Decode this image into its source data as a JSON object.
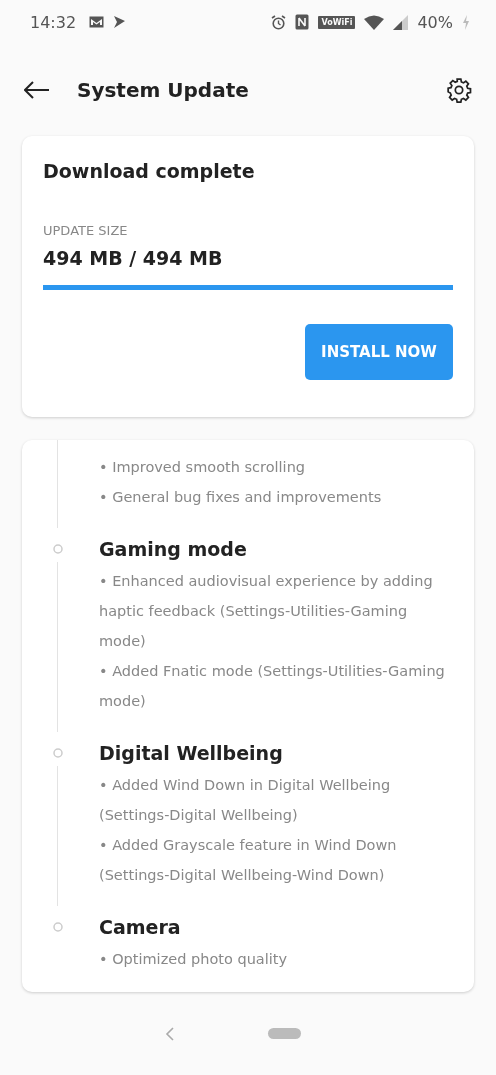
{
  "status_bar": {
    "time": "14:32",
    "wifi_calling": "VoWiFi",
    "battery": "40%"
  },
  "app_bar": {
    "title": "System Update"
  },
  "download": {
    "title": "Download complete",
    "size_label": "UPDATE SIZE",
    "size": "494 MB / 494 MB",
    "level": 1.0,
    "button": "INSTALL NOW"
  },
  "changelog": [
    {
      "items": [
        "• Improved smooth scrolling",
        "• General bug fixes and improvements"
      ]
    },
    {
      "heading": "Gaming mode",
      "items": [
        "• Enhanced audiovisual experience by adding haptic feedback (Settings-Utilities-Gaming mode)",
        "• Added Fnatic mode (Settings-Utilities-Gaming mode)"
      ]
    },
    {
      "heading": "Digital Wellbeing",
      "items": [
        "• Added Wind Down in Digital Wellbeing (Settings-Digital Wellbeing)",
        "• Added Grayscale feature in Wind Down (Settings-Digital Wellbeing-Wind Down)"
      ]
    },
    {
      "heading": "Camera",
      "items": [
        "• Optimized photo quality"
      ]
    }
  ]
}
